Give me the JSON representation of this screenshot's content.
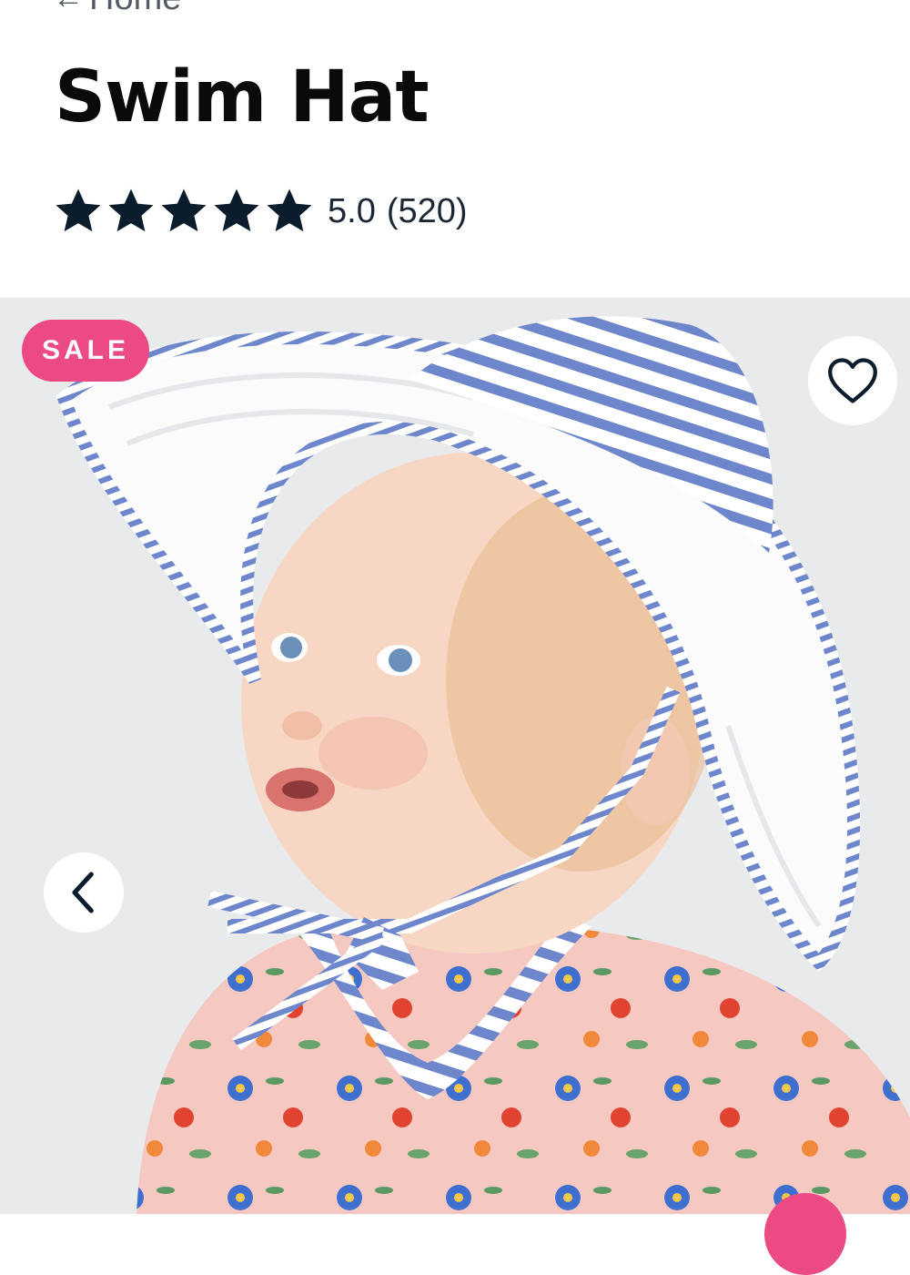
{
  "breadcrumb": {
    "arrow_icon": "arrow-left-icon",
    "label": "Home"
  },
  "product": {
    "title": "Swim Hat",
    "rating_value": "5.0",
    "rating_count": "(520)",
    "star_count": 5
  },
  "gallery": {
    "badge": "SALE",
    "favorite_icon": "heart-icon",
    "prev_icon": "chevron-left-icon"
  },
  "colors": {
    "accent": "#ec4a85",
    "star": "#0b1c2c",
    "gallery_bg": "#e9eaec"
  }
}
